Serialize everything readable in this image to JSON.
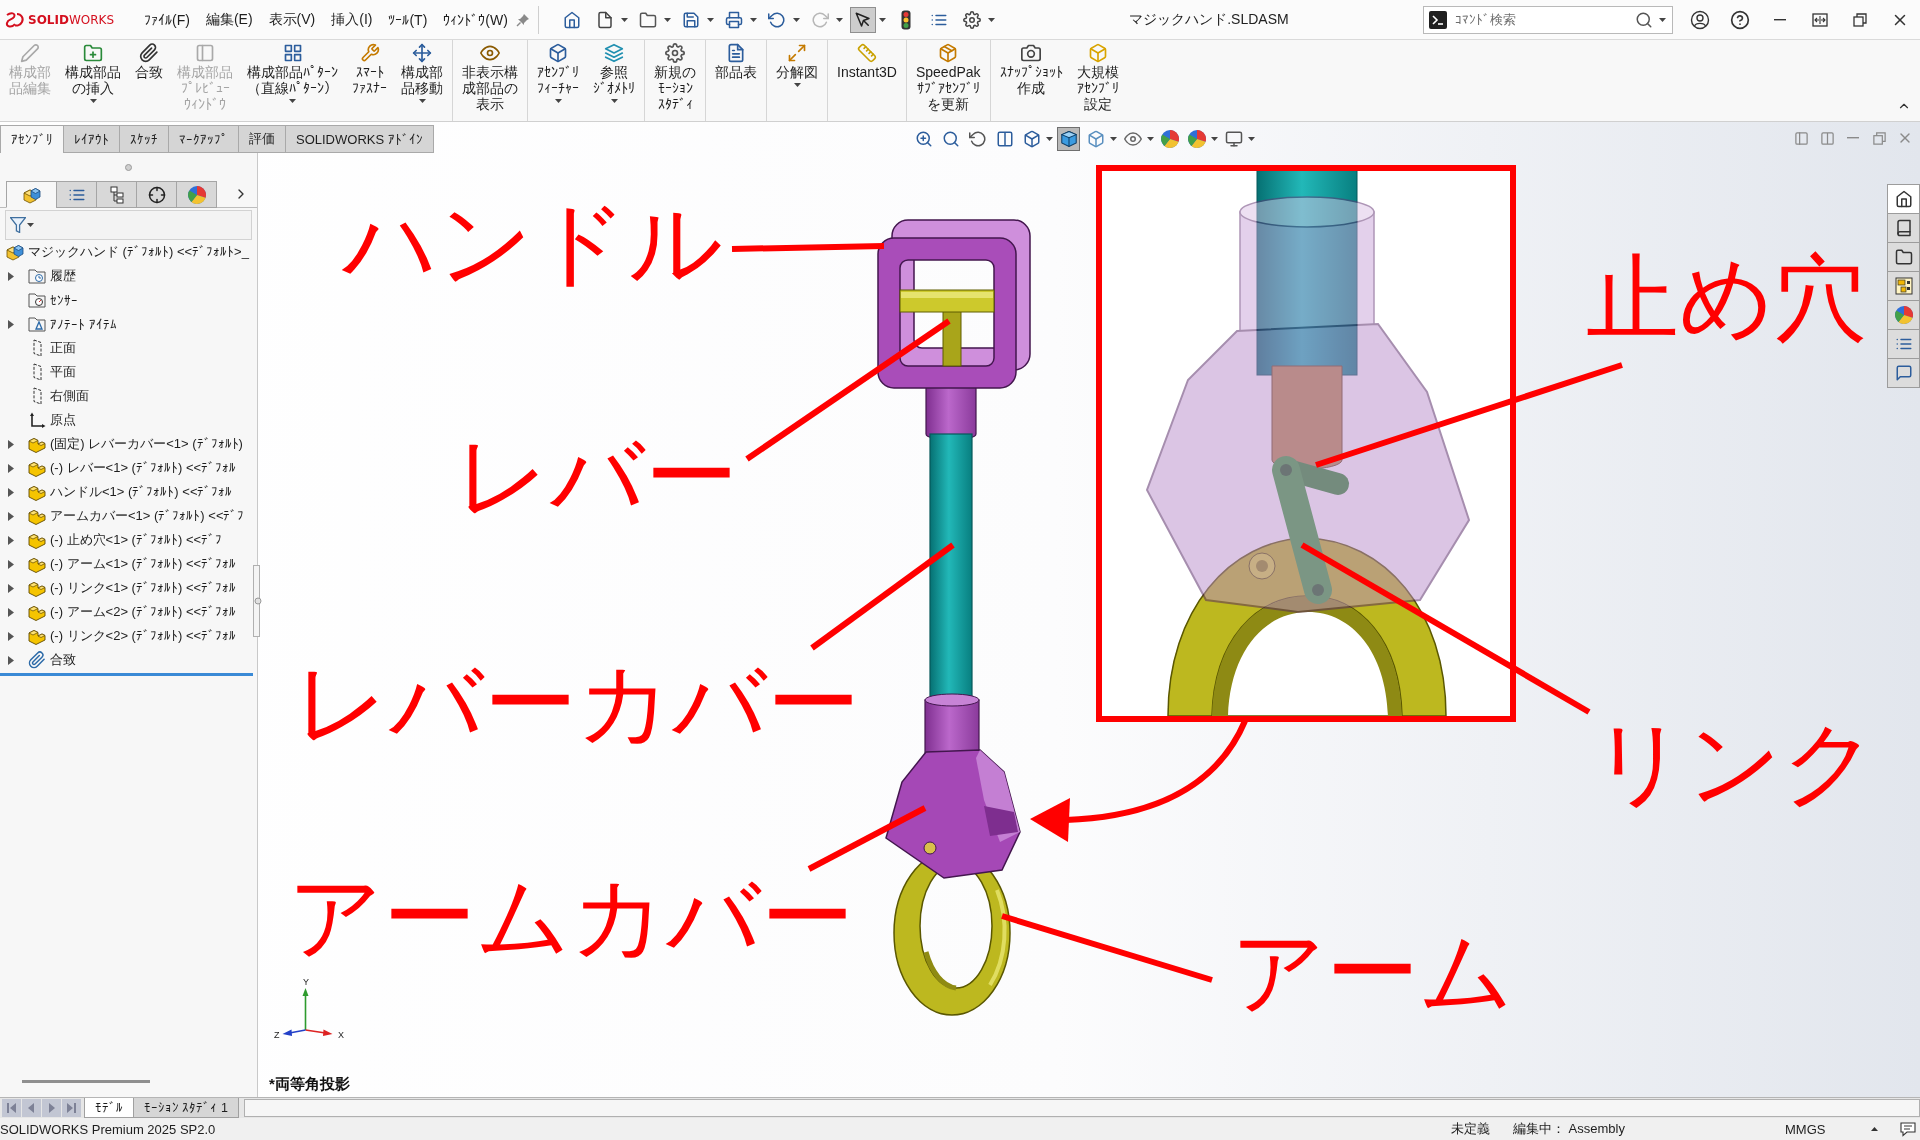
{
  "title_bar": {
    "logo": "**SOLID**WORKS",
    "menus": [
      "ﾌｧｲﾙ(F)",
      "編集(E)",
      "表示(V)",
      "挿入(I)",
      "ﾂｰﾙ(T)",
      "ｳｨﾝﾄﾞｳ(W)"
    ],
    "quick_access": [
      {
        "kind": "home",
        "dropdown": false,
        "pressed": false,
        "disabled": false
      },
      {
        "kind": "new",
        "dropdown": true,
        "pressed": false,
        "disabled": false
      },
      {
        "kind": "open",
        "dropdown": true,
        "pressed": false,
        "disabled": false
      },
      {
        "kind": "save",
        "dropdown": true,
        "pressed": false,
        "disabled": false
      },
      {
        "kind": "print",
        "dropdown": true,
        "pressed": false,
        "disabled": false
      },
      {
        "kind": "undo",
        "dropdown": true,
        "pressed": false,
        "disabled": false
      },
      {
        "kind": "redo",
        "dropdown": true,
        "pressed": false,
        "disabled": true
      },
      {
        "kind": "select",
        "dropdown": true,
        "pressed": true,
        "disabled": false
      },
      {
        "kind": "rebuild",
        "dropdown": false,
        "pressed": false,
        "disabled": false
      },
      {
        "kind": "props",
        "dropdown": false,
        "pressed": false,
        "disabled": false
      },
      {
        "kind": "options",
        "dropdown": true,
        "pressed": false,
        "disabled": false
      }
    ],
    "title": "マジックハンド.SLDASM",
    "search": {
      "placeholder": "ｺﾏﾝﾄﾞ検索"
    }
  },
  "ribbon": {
    "groups": [
      {
        "buttons": [
          {
            "kind": "edit",
            "label": "構成部品編集",
            "disabled": true,
            "dropdown": false
          },
          {
            "kind": "insert",
            "label": "構成部品の挿入",
            "disabled": false,
            "dropdown": true
          },
          {
            "kind": "mate",
            "label": "合致",
            "disabled": false,
            "dropdown": false
          },
          {
            "kind": "preview",
            "label": "構成部品ﾌﾟﾚﾋﾞｭｰｳｨﾝﾄﾞｳ",
            "disabled": true,
            "dropdown": false
          },
          {
            "kind": "pattern",
            "label": "構成部品ﾊﾟﾀｰﾝ（直線ﾊﾟﾀｰﾝ）",
            "disabled": false,
            "dropdown": true
          },
          {
            "kind": "fastener",
            "label": "ｽﾏｰﾄﾌｧｽﾅｰ",
            "disabled": false,
            "dropdown": false
          },
          {
            "kind": "move",
            "label": "構成部品移動",
            "disabled": false,
            "dropdown": true
          }
        ]
      },
      {
        "buttons": [
          {
            "kind": "show",
            "label": "非表示構成部品の表示",
            "disabled": false,
            "dropdown": false
          }
        ]
      },
      {
        "buttons": [
          {
            "kind": "feature",
            "label": "ｱｾﾝﾌﾞﾘﾌｨｰﾁｬｰ",
            "disabled": false,
            "dropdown": true
          },
          {
            "kind": "reference",
            "label": "参照ｼﾞｵﾒﾄﾘ",
            "disabled": false,
            "dropdown": true
          }
        ]
      },
      {
        "buttons": [
          {
            "kind": "motion",
            "label": "新規のﾓｰｼｮﾝｽﾀﾃﾞｨ",
            "disabled": false,
            "dropdown": false
          }
        ]
      },
      {
        "buttons": [
          {
            "kind": "bom",
            "label": "部品表",
            "disabled": false,
            "dropdown": false
          }
        ]
      },
      {
        "buttons": [
          {
            "kind": "explode",
            "label": "分解図",
            "disabled": false,
            "dropdown": true
          }
        ]
      },
      {
        "buttons": [
          {
            "kind": "instant3d",
            "label": "Instant3D",
            "disabled": false,
            "dropdown": false
          }
        ]
      },
      {
        "buttons": [
          {
            "kind": "speedpak",
            "label": "SpeedPak ｻﾌﾞｱｾﾝﾌﾞﾘを更新",
            "disabled": false,
            "dropdown": false
          }
        ]
      },
      {
        "buttons": [
          {
            "kind": "snapshot",
            "label": "ｽﾅｯﾌﾟｼｮｯﾄ作成",
            "disabled": false,
            "dropdown": false
          },
          {
            "kind": "large",
            "label": "大規模ｱｾﾝﾌﾞﾘ設定",
            "disabled": false,
            "dropdown": false
          }
        ]
      }
    ]
  },
  "command_tabs": [
    {
      "label": "ｱｾﾝﾌﾞﾘ",
      "selected": true
    },
    {
      "label": "ﾚｲｱｳﾄ",
      "selected": false
    },
    {
      "label": "ｽｹｯﾁ",
      "selected": false
    },
    {
      "label": "ﾏｰｸｱｯﾌﾟ",
      "selected": false
    },
    {
      "label": "評価",
      "selected": false
    },
    {
      "label": "SOLIDWORKS ｱﾄﾞｲﾝ",
      "selected": false
    }
  ],
  "view_toolbar": [
    {
      "kind": "zoomfit",
      "dropdown": false,
      "pressed": false
    },
    {
      "kind": "zoomarea",
      "dropdown": false,
      "pressed": false
    },
    {
      "kind": "previous",
      "dropdown": false,
      "pressed": false
    },
    {
      "kind": "section",
      "dropdown": false,
      "pressed": false
    },
    {
      "kind": "orientation",
      "dropdown": true,
      "pressed": false
    },
    {
      "kind": "shaded",
      "dropdown": false,
      "pressed": true
    },
    {
      "kind": "hide",
      "dropdown": true,
      "pressed": false
    },
    {
      "kind": "visibility",
      "dropdown": true,
      "pressed": false
    },
    {
      "kind": "appearance",
      "dropdown": false,
      "pressed": false
    },
    {
      "kind": "scene",
      "dropdown": true,
      "pressed": false
    },
    {
      "kind": "display",
      "dropdown": true,
      "pressed": false
    }
  ],
  "feature_manager": {
    "tabs": [
      {
        "kind": "tree",
        "selected": true
      },
      {
        "kind": "properties",
        "selected": false
      },
      {
        "kind": "configurations",
        "selected": false
      },
      {
        "kind": "dimxpert",
        "selected": false
      },
      {
        "kind": "display",
        "selected": false
      }
    ],
    "tree": {
      "kind": "assembly",
      "label": "マジックハンド (ﾃﾞﾌｫﾙﾄ) <<ﾃﾞﾌｫﾙﾄ>_",
      "children": [
        {
          "kind": "history",
          "label": "履歴",
          "expandable": true
        },
        {
          "kind": "sensors",
          "label": "ｾﾝｻｰ",
          "expandable": false
        },
        {
          "kind": "annotations",
          "label": "ｱﾉﾃｰﾄ ｱｲﾃﾑ",
          "expandable": true
        },
        {
          "kind": "plane",
          "label": "正面",
          "expandable": false
        },
        {
          "kind": "plane",
          "label": "平面",
          "expandable": false
        },
        {
          "kind": "plane",
          "label": "右側面",
          "expandable": false
        },
        {
          "kind": "origin",
          "label": "原点",
          "expandable": false
        },
        {
          "kind": "part",
          "label": "(固定) レバーカバー<1> (ﾃﾞﾌｫﾙﾄ)",
          "expandable": true
        },
        {
          "kind": "part",
          "label": "(-) レバー<1> (ﾃﾞﾌｫﾙﾄ) <<ﾃﾞﾌｫﾙ",
          "expandable": true
        },
        {
          "kind": "part",
          "label": "ハンドル<1> (ﾃﾞﾌｫﾙﾄ) <<ﾃﾞﾌｫﾙ",
          "expandable": true
        },
        {
          "kind": "part",
          "label": "アームカバー<1> (ﾃﾞﾌｫﾙﾄ) <<ﾃﾞﾌ",
          "expandable": true
        },
        {
          "kind": "part",
          "label": "(-) 止め穴<1> (ﾃﾞﾌｫﾙﾄ) <<ﾃﾞﾌ",
          "expandable": true
        },
        {
          "kind": "part",
          "label": "(-) アーム<1> (ﾃﾞﾌｫﾙﾄ) <<ﾃﾞﾌｫﾙ",
          "expandable": true
        },
        {
          "kind": "part",
          "label": "(-) リンク<1> (ﾃﾞﾌｫﾙﾄ) <<ﾃﾞﾌｫﾙ",
          "expandable": true
        },
        {
          "kind": "part",
          "label": "(-) アーム<2> (ﾃﾞﾌｫﾙﾄ) <<ﾃﾞﾌｫﾙ",
          "expandable": true
        },
        {
          "kind": "part",
          "label": "(-) リンク<2> (ﾃﾞﾌｫﾙﾄ) <<ﾃﾞﾌｫﾙ",
          "expandable": true
        },
        {
          "kind": "mates",
          "label": "合致",
          "expandable": true
        }
      ]
    }
  },
  "canvas": {
    "callouts": [
      {
        "label": "ハンドル"
      },
      {
        "label": "止め穴"
      },
      {
        "label": "レバー"
      },
      {
        "label": "レバーカバー"
      },
      {
        "label": "リンク"
      },
      {
        "label": "アームカバー"
      },
      {
        "label": "アーム"
      }
    ],
    "triad": {
      "y": "Y",
      "x": "X",
      "z": "Z"
    },
    "view_orientation": "*両等角投影"
  },
  "task_pane": [
    {
      "kind": "home",
      "selected": true
    },
    {
      "kind": "library",
      "selected": false
    },
    {
      "kind": "explorer",
      "selected": false
    },
    {
      "kind": "palette",
      "selected": false
    },
    {
      "kind": "appearances",
      "selected": false
    },
    {
      "kind": "properties",
      "selected": false
    },
    {
      "kind": "forum",
      "selected": false
    }
  ],
  "model_tabs": [
    {
      "label": "ﾓﾃﾞﾙ",
      "selected": true
    },
    {
      "label": "ﾓｰｼｮﾝ ｽﾀﾃﾞｨ 1",
      "selected": false
    }
  ],
  "status_bar": {
    "product": "SOLIDWORKS Premium 2025 SP2.0",
    "state": "未定義",
    "editing": "編集中： Assembly",
    "units": "MMGS"
  }
}
